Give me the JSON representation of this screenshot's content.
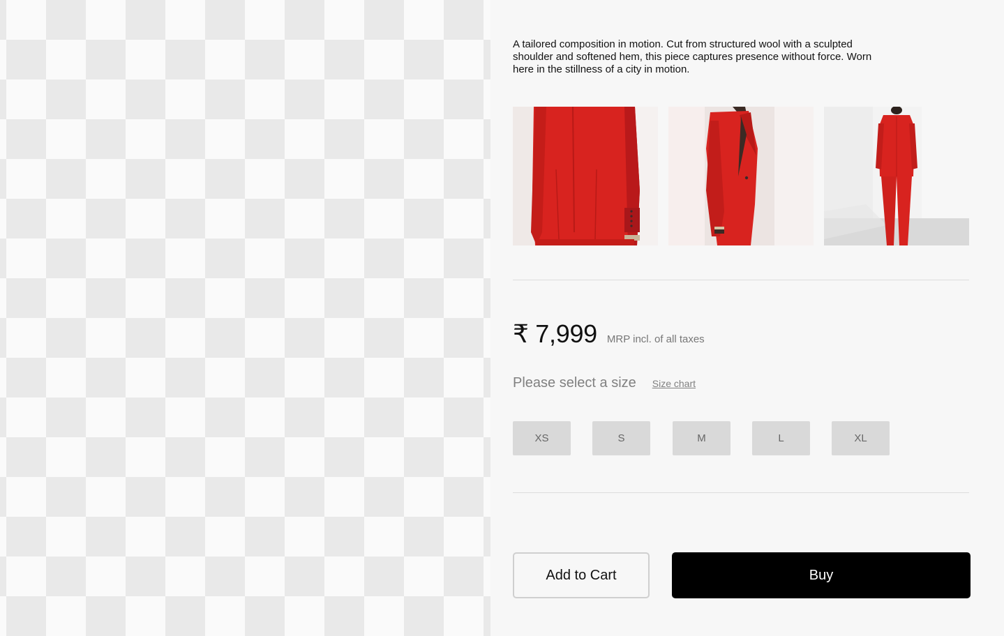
{
  "product": {
    "description": "A tailored composition in motion. Cut from structured wool with a sculpted shoulder and softened hem, this piece captures presence without force. Worn here in the stillness of a city in motion.",
    "gallery": [
      {
        "name": "back-detail",
        "accent": "#d8231f"
      },
      {
        "name": "side-view",
        "accent": "#d8231f"
      },
      {
        "name": "full-back-view",
        "accent": "#d8231f"
      }
    ]
  },
  "pricing": {
    "price": "₹ 7,999",
    "note": "MRP incl. of all taxes"
  },
  "size_selector": {
    "prompt": "Please select a size",
    "chart_link": "Size chart",
    "options": [
      "XS",
      "S",
      "M",
      "L",
      "XL"
    ]
  },
  "actions": {
    "add_to_cart": "Add to Cart",
    "buy": "Buy"
  },
  "colors": {
    "background": "#f7f7f7",
    "primary_button": "#000000",
    "size_button": "#d9d9d9",
    "garment_red": "#d8231f"
  }
}
